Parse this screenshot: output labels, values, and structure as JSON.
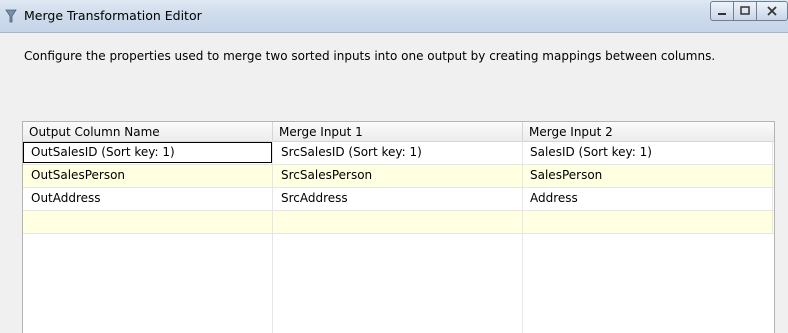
{
  "window": {
    "title": "Merge Transformation Editor",
    "icon": "ssis-transform-icon"
  },
  "description": "Configure the properties used to merge two sorted inputs into one output by creating mappings between columns.",
  "grid": {
    "headers": [
      "Output Column Name",
      "Merge Input 1",
      "Merge Input 2"
    ],
    "rows": [
      [
        "OutSalesID (Sort key: 1)",
        "SrcSalesID (Sort key: 1)",
        "SalesID (Sort key: 1)"
      ],
      [
        "OutSalesPerson",
        "SrcSalesPerson",
        "SalesPerson"
      ],
      [
        "OutAddress",
        "SrcAddress",
        "Address"
      ],
      [
        "",
        "",
        ""
      ]
    ]
  },
  "colors": {
    "alt_row": "#ffffe1",
    "title_bar": "#cfdcec"
  }
}
